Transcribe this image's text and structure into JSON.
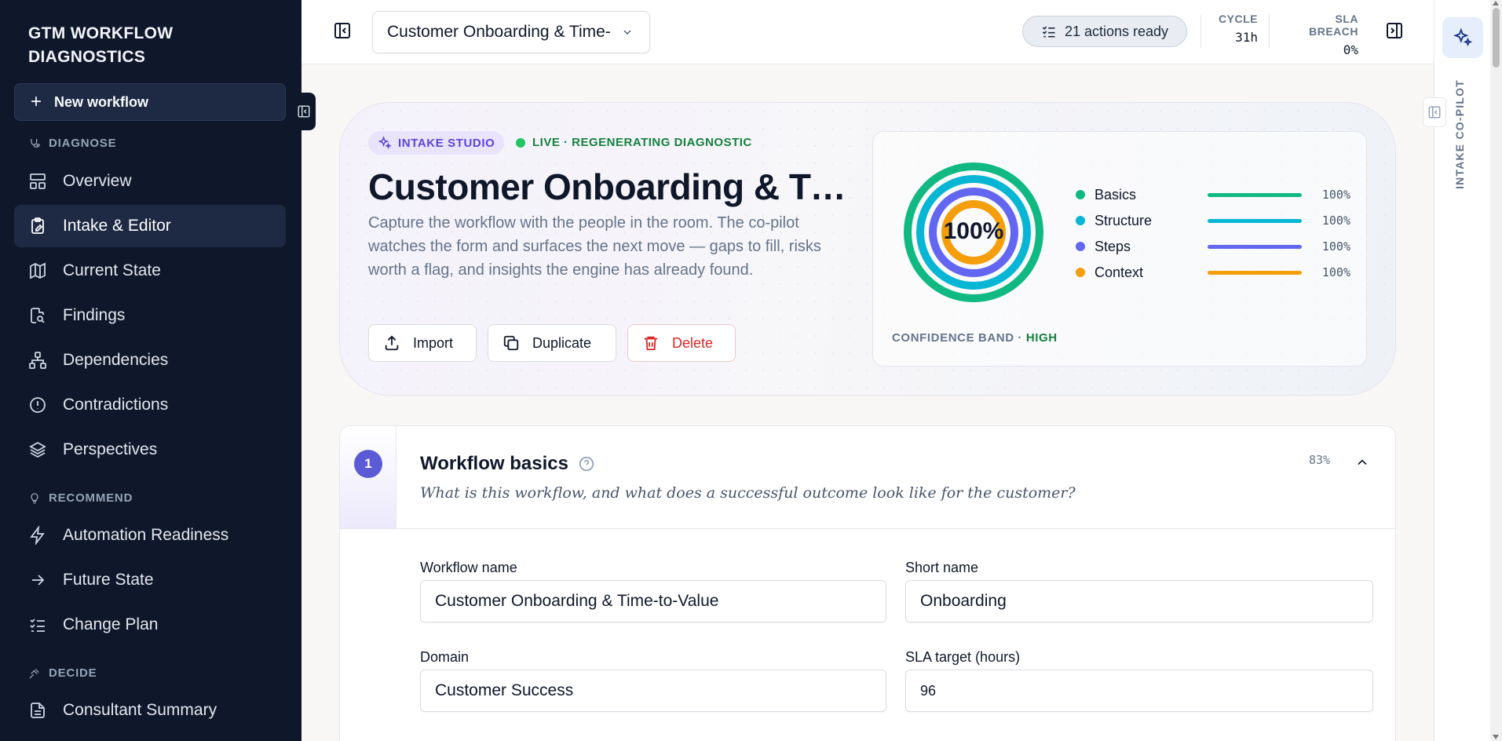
{
  "sidebar": {
    "brand_line1": "GTM WORKFLOW",
    "brand_line2": "DIAGNOSTICS",
    "new_workflow": "New workflow",
    "sections": {
      "diagnose": "DIAGNOSE",
      "recommend": "RECOMMEND",
      "decide": "DECIDE"
    },
    "items": [
      {
        "label": "Overview",
        "icon": "layout-icon"
      },
      {
        "label": "Intake & Editor",
        "icon": "clipboard-edit-icon",
        "active": true
      },
      {
        "label": "Current State",
        "icon": "map-icon"
      },
      {
        "label": "Findings",
        "icon": "file-search-icon"
      },
      {
        "label": "Dependencies",
        "icon": "network-icon"
      },
      {
        "label": "Contradictions",
        "icon": "alert-circle-icon"
      },
      {
        "label": "Perspectives",
        "icon": "layers-icon"
      },
      {
        "label": "Automation Readiness",
        "icon": "zap-icon"
      },
      {
        "label": "Future State",
        "icon": "arrow-right-icon"
      },
      {
        "label": "Change Plan",
        "icon": "list-checks-icon"
      },
      {
        "label": "Consultant Summary",
        "icon": "file-text-icon"
      }
    ]
  },
  "topbar": {
    "workflow_select": "Customer Onboarding & Time-",
    "actions_ready": "21 actions ready",
    "cycle_label": "CYCLE",
    "cycle_value": "31h",
    "sla_label": "SLA BREACH",
    "sla_value": "0%"
  },
  "rail": {
    "label": "INTAKE CO-PILOT"
  },
  "hero": {
    "badge": "INTAKE STUDIO",
    "live": "LIVE · REGENERATING DIAGNOSTIC",
    "title": "Customer Onboarding & Time-to-Value",
    "description": "Capture the workflow with the people in the room. The co-pilot watches the form and surfaces the next move — gaps to fill, risks worth a flag, and insights the engine has already found.",
    "buttons": {
      "import": "Import",
      "duplicate": "Duplicate",
      "delete": "Delete"
    },
    "confidence": {
      "overall": "100%",
      "band_label": "CONFIDENCE BAND · ",
      "band_value": "HIGH",
      "rows": [
        {
          "name": "Basics",
          "value": "100%",
          "pct": 100,
          "color": "#10b981"
        },
        {
          "name": "Structure",
          "value": "100%",
          "pct": 100,
          "color": "#06b6d4"
        },
        {
          "name": "Steps",
          "value": "100%",
          "pct": 100,
          "color": "#6366f1"
        },
        {
          "name": "Context",
          "value": "100%",
          "pct": 100,
          "color": "#f59e0b"
        }
      ]
    }
  },
  "section": {
    "number": "1",
    "title": "Workflow basics",
    "subtitle": "What is this workflow, and what does a successful outcome look like for the customer?",
    "completion": "83%",
    "fields": {
      "workflow_name_label": "Workflow name",
      "workflow_name_value": "Customer Onboarding & Time-to-Value",
      "short_name_label": "Short name",
      "short_name_value": "Onboarding",
      "domain_label": "Domain",
      "domain_value": "Customer Success",
      "sla_label": "SLA target (hours)",
      "sla_value": "96"
    }
  }
}
